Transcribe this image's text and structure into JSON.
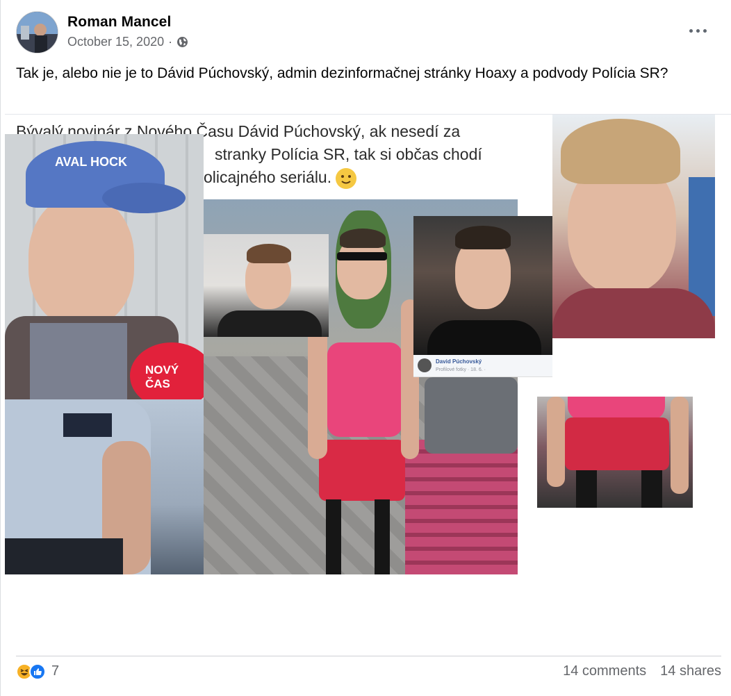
{
  "post": {
    "author": "Roman Mancel",
    "date": "October 15, 2020",
    "separator": "·",
    "audience_icon": "globe-icon",
    "more_icon": "more-options-icon",
    "caption": "Tak je, alebo nie je to Dávid Púchovský, admin dezinformačnej stránky Hoaxy a podvody Polícia SR?"
  },
  "media": {
    "text_lines": [
      "Bývalý novinár z Nového Času Dávid Púchovský, ak nesedí za",
      "stranky Polícia SR, tak si občas chodí",
      "olicajného seriálu."
    ],
    "emoji": "slightly-smiling-face-icon",
    "profile_strip": {
      "name": "David Púchovský",
      "sub": "Profilové fotky · 18. 6. ·"
    },
    "mic_text": "NOVÝ ČAS",
    "cap_text": "AVAL HOCK"
  },
  "footer": {
    "reaction_icons": [
      "haha-icon",
      "like-icon"
    ],
    "reaction_count": "7",
    "comments": "14 comments",
    "shares": "14 shares"
  },
  "colors": {
    "text_primary": "#050505",
    "text_secondary": "#65676b",
    "like_blue": "#1877f2",
    "haha_yellow": "#f7b125"
  }
}
